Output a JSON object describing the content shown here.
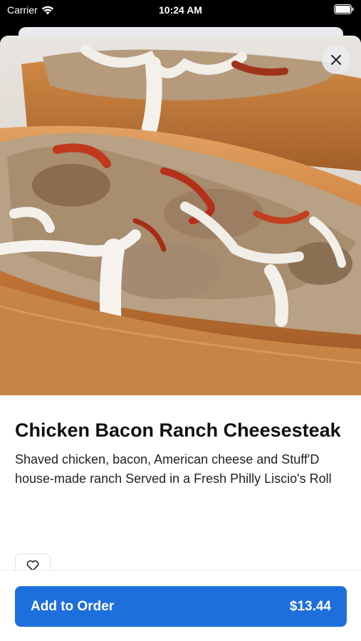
{
  "status_bar": {
    "carrier": "Carrier",
    "time": "10:24 AM"
  },
  "item": {
    "title": "Chicken Bacon Ranch Cheesesteak",
    "description": "Shaved chicken, bacon, American cheese and Stuff'D house-made ranch Served in a Fresh Philly Liscio's Roll"
  },
  "footer": {
    "add_label": "Add to Order",
    "price": "$13.44"
  },
  "colors": {
    "accent": "#1d6fdc"
  },
  "icons": {
    "close": "close-icon",
    "favorite": "heart-icon",
    "wifi": "wifi-icon",
    "battery": "battery-icon"
  }
}
